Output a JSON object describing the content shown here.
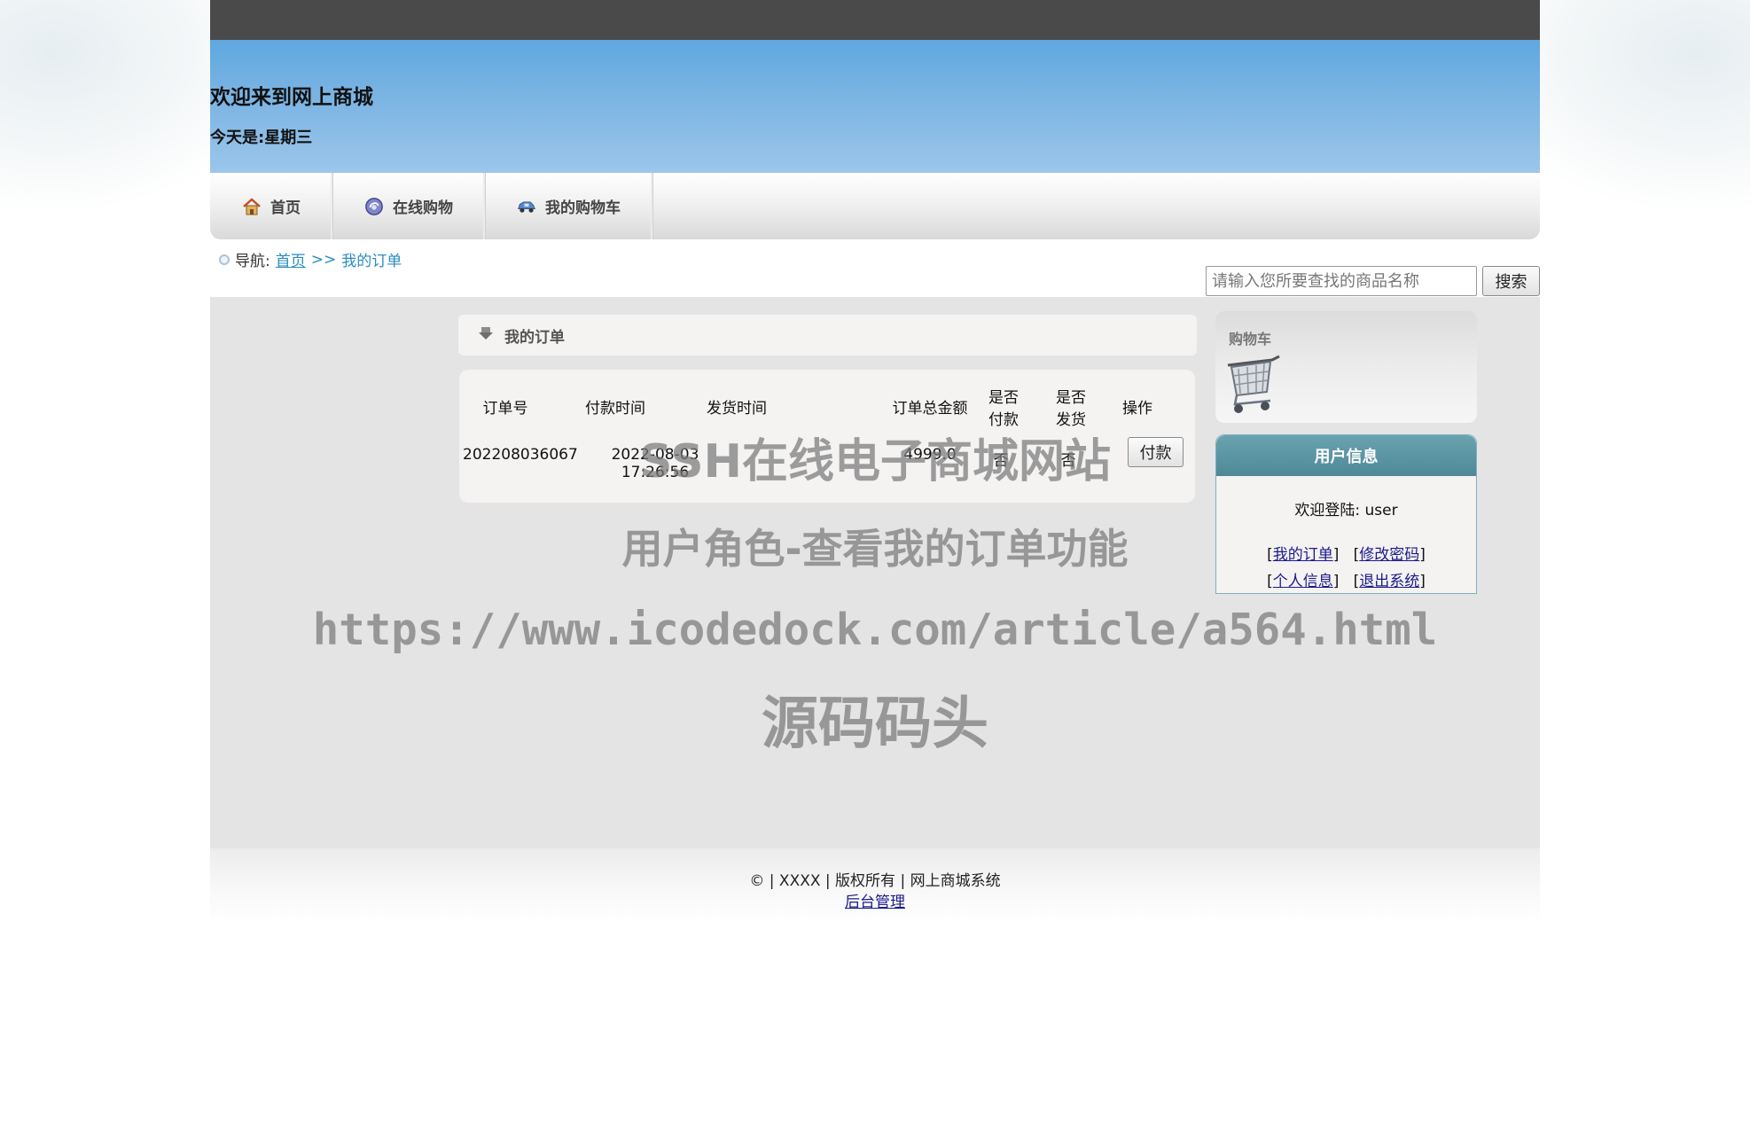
{
  "header": {
    "welcome": "欢迎来到网上商城",
    "today": "今天是:星期三"
  },
  "nav": {
    "items": [
      {
        "label": "首页",
        "icon": "home-icon"
      },
      {
        "label": "在线购物",
        "icon": "shopping-icon"
      },
      {
        "label": "我的购物车",
        "icon": "car-icon"
      }
    ]
  },
  "breadcrumb": {
    "prefix": "导航:",
    "home": "首页",
    "separator": ">>",
    "current": "我的订单"
  },
  "search": {
    "placeholder": "请输入您所要查找的商品名称",
    "button": "搜索"
  },
  "orders": {
    "title": "我的订单",
    "columns": [
      "订单号",
      "付款时间",
      "发货时间",
      "订单总金额",
      "是否付款",
      "是否发货",
      "操作"
    ],
    "rows": [
      {
        "order_no": "202208036067",
        "pay_time": "2022-08-03 17:26:56",
        "ship_time": "",
        "total": "4999.0",
        "paid": "否",
        "shipped": "否",
        "action": "付款"
      }
    ]
  },
  "cart": {
    "title": "购物车"
  },
  "user": {
    "title": "用户信息",
    "greeting": "欢迎登陆: user",
    "links": [
      "我的订单",
      "修改密码",
      "个人信息",
      "退出系统"
    ]
  },
  "footer": {
    "copyright": "© | XXXX | 版权所有 | 网上商城系统",
    "admin": "后台管理"
  },
  "watermark": {
    "line1": "SSH在线电子商城网站",
    "line2": "用户角色-查看我的订单功能",
    "line3": "https://www.icodedock.com/article/a564.html",
    "line4": "源码码头"
  },
  "colors": {
    "topbar": "#4a4a4a",
    "banner": "#6fb0e2",
    "link": "#2a8cbf",
    "user_header": "#5a95a3",
    "content_bg": "#e5e4e4"
  }
}
